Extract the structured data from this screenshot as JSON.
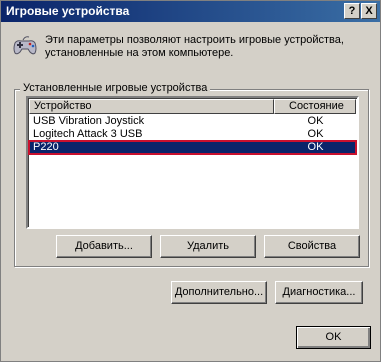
{
  "window": {
    "title": "Игровые устройства",
    "help_label": "?",
    "close_label": "X"
  },
  "intro": {
    "text": "Эти параметры позволяют настроить игровые устройства, установленные на этом компьютере.",
    "icon": "gamepad-icon"
  },
  "group": {
    "label": "Установленные игровые устройства"
  },
  "list": {
    "columns": [
      "Устройство",
      "Состояние"
    ],
    "rows": [
      {
        "device": "USB Vibration Joystick",
        "status": "OK"
      },
      {
        "device": "Logitech Attack 3 USB",
        "status": "OK"
      },
      {
        "device": "P220",
        "status": "OK",
        "selected": true
      }
    ]
  },
  "buttons": {
    "add": "Добавить...",
    "remove": "Удалить",
    "properties": "Свойства",
    "advanced": "Дополнительно...",
    "diagnostics": "Диагностика...",
    "ok": "OK"
  },
  "colors": {
    "titlebar_start": "#0a246a",
    "titlebar_end": "#3a6ea5",
    "selection": "#0a246a",
    "highlight_outline": "#c8102e"
  }
}
